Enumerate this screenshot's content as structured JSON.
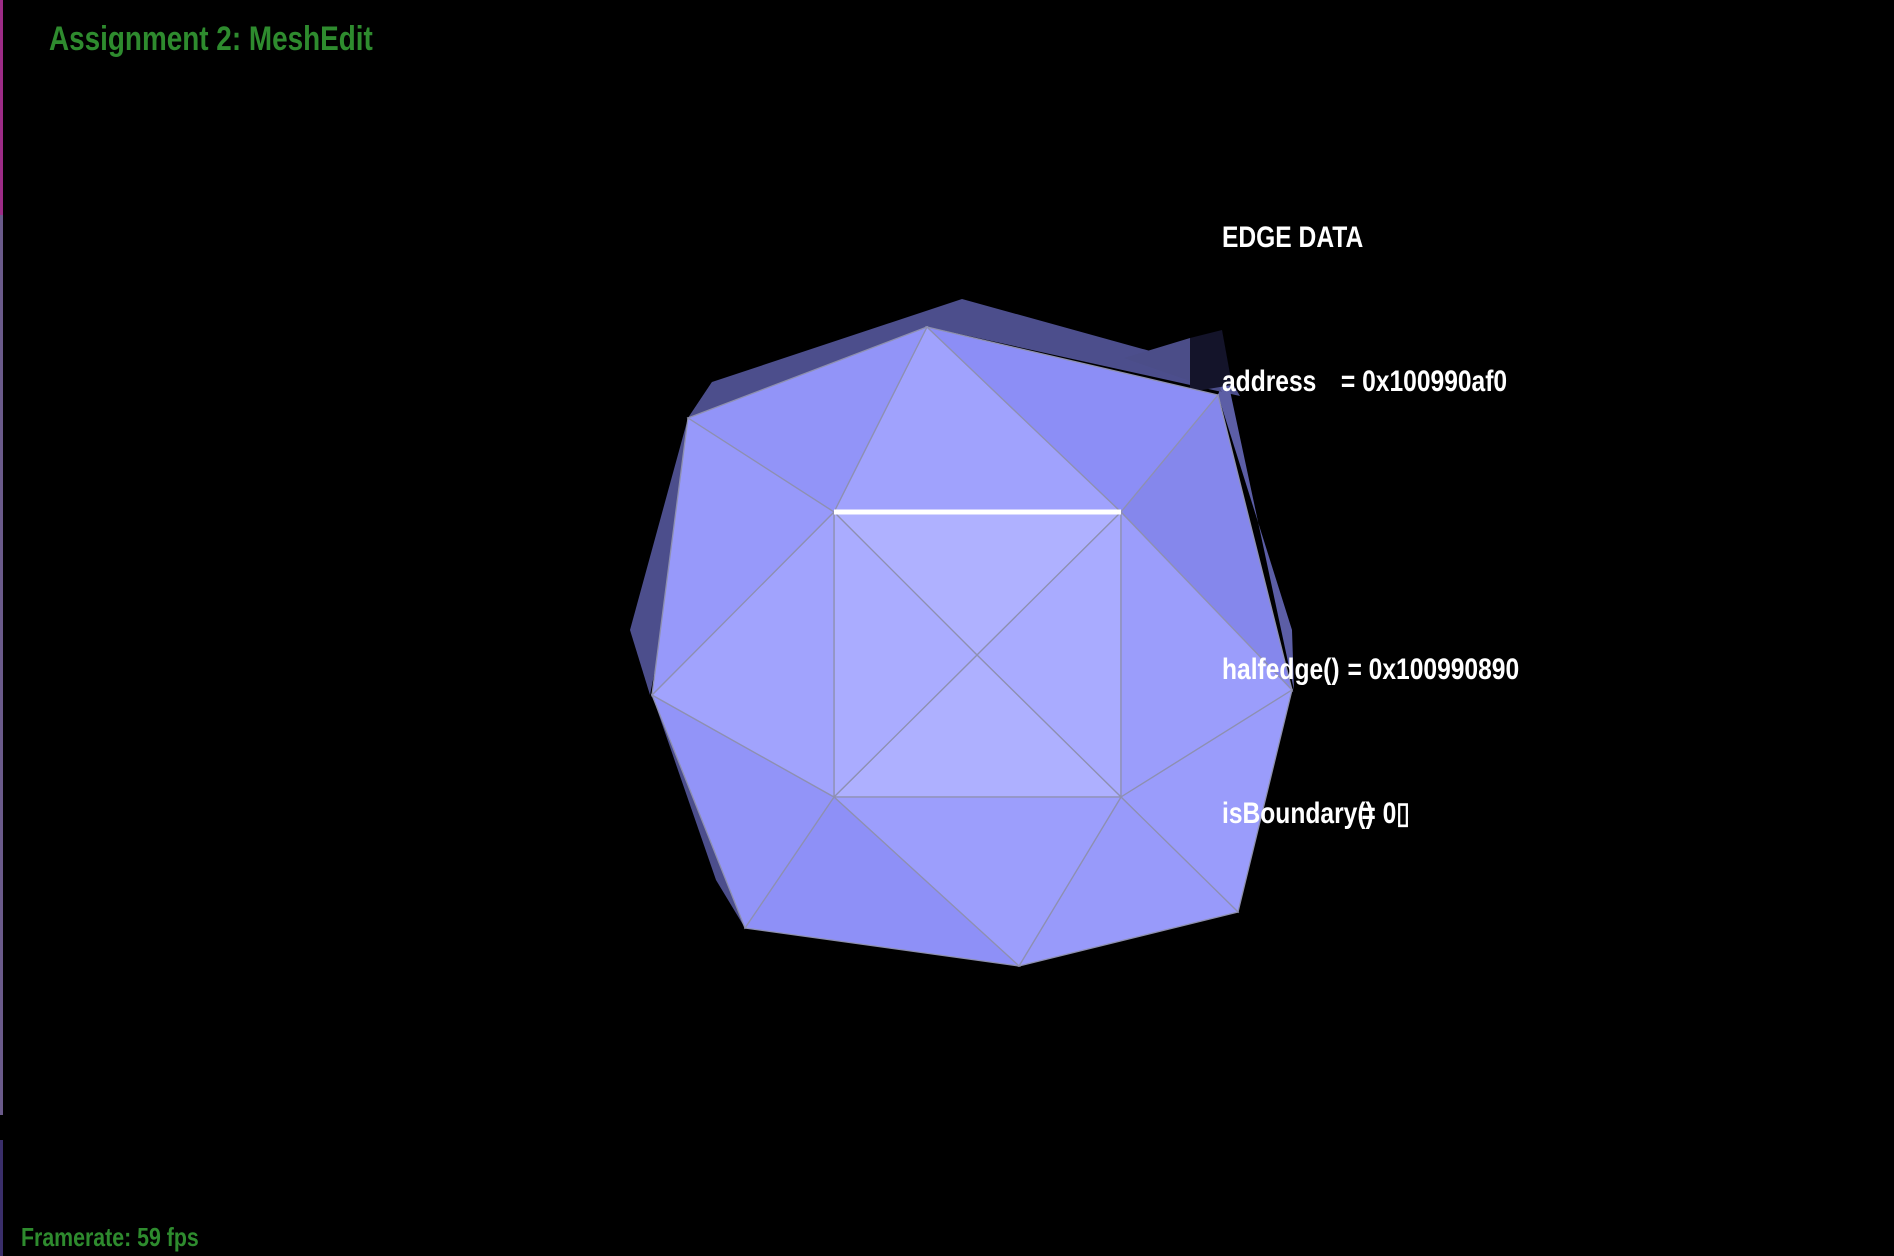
{
  "window": {
    "title": "Assignment 2: MeshEdit"
  },
  "edge_data": {
    "heading": "EDGE DATA",
    "rows": [
      {
        "key": "address",
        "value": "= 0x100990af0"
      },
      {
        "key": "",
        "value": ""
      },
      {
        "key": "halfedge()",
        "value": "= 0x100990890"
      },
      {
        "key": "isBoundary()",
        "value": "= 0▯"
      }
    ]
  },
  "status": {
    "framerate": "Framerate: 59 fps"
  },
  "colors": {
    "title": "#2e8b2e",
    "framerate": "#2e8b2e",
    "background": "#000000",
    "mesh_front": "#a6a8ff",
    "mesh_side": "#8c8ef5",
    "mesh_dark": "#4b4d88",
    "mesh_lines": "#8e90b0",
    "selected_edge": "#ffffff",
    "left_edge_top": "#9c2b86",
    "left_edge_mid": "#6a5a8a",
    "left_edge_bottom": "#3a2e6a"
  }
}
